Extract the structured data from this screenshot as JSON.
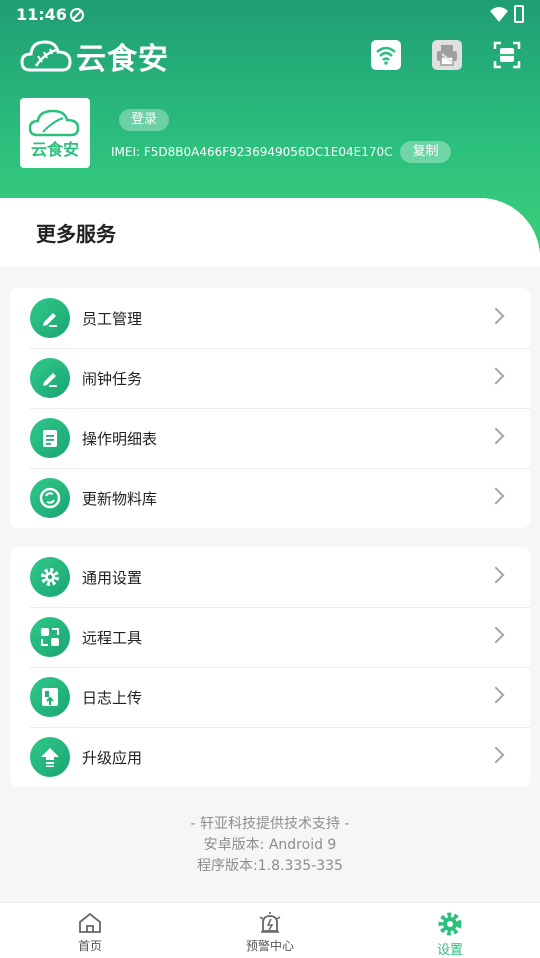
{
  "status_bar": {
    "time": "11:46"
  },
  "brand": {
    "name": "云食安",
    "avatar_text": "云食安"
  },
  "user": {
    "login_label": "登录",
    "imei_text": "IMEI: F5D8B0A466F9236949056DC1E04E170C",
    "copy_label": "复制"
  },
  "section": {
    "title": "更多服务"
  },
  "menu_group_1": [
    {
      "label": "员工管理",
      "icon": "pencil-icon"
    },
    {
      "label": "闹钟任务",
      "icon": "pencil-icon"
    },
    {
      "label": "操作明细表",
      "icon": "notepad-icon"
    },
    {
      "label": "更新物料库",
      "icon": "refresh-icon"
    }
  ],
  "menu_group_2": [
    {
      "label": "通用设置",
      "icon": "gear-icon"
    },
    {
      "label": "远程工具",
      "icon": "remote-tool-icon"
    },
    {
      "label": "日志上传",
      "icon": "log-upload-icon"
    },
    {
      "label": "升级应用",
      "icon": "upgrade-icon"
    }
  ],
  "footer": {
    "support": "- 轩亚科技提供技术支持 -",
    "android_version": "安卓版本: Android 9",
    "app_version": "程序版本:1.8.335-335"
  },
  "tabs": [
    {
      "label": "首页",
      "icon": "home-icon"
    },
    {
      "label": "预警中心",
      "icon": "alarm-icon"
    },
    {
      "label": "设置",
      "icon": "gear-icon"
    }
  ],
  "colors": {
    "accent": "#2cc07d",
    "header_start": "#1f9e74",
    "header_end": "#3dd27a"
  }
}
